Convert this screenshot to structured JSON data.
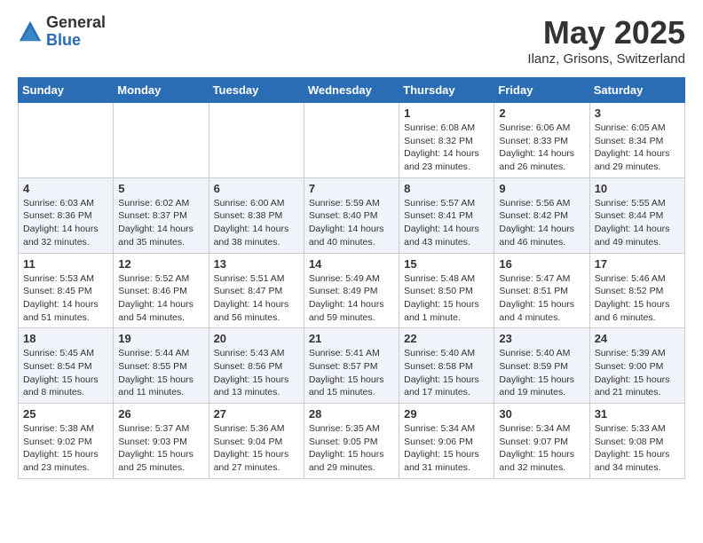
{
  "logo": {
    "general": "General",
    "blue": "Blue"
  },
  "title": "May 2025",
  "location": "Ilanz, Grisons, Switzerland",
  "weekdays": [
    "Sunday",
    "Monday",
    "Tuesday",
    "Wednesday",
    "Thursday",
    "Friday",
    "Saturday"
  ],
  "weeks": [
    [
      {
        "day": "",
        "info": ""
      },
      {
        "day": "",
        "info": ""
      },
      {
        "day": "",
        "info": ""
      },
      {
        "day": "",
        "info": ""
      },
      {
        "day": "1",
        "info": "Sunrise: 6:08 AM\nSunset: 8:32 PM\nDaylight: 14 hours\nand 23 minutes."
      },
      {
        "day": "2",
        "info": "Sunrise: 6:06 AM\nSunset: 8:33 PM\nDaylight: 14 hours\nand 26 minutes."
      },
      {
        "day": "3",
        "info": "Sunrise: 6:05 AM\nSunset: 8:34 PM\nDaylight: 14 hours\nand 29 minutes."
      }
    ],
    [
      {
        "day": "4",
        "info": "Sunrise: 6:03 AM\nSunset: 8:36 PM\nDaylight: 14 hours\nand 32 minutes."
      },
      {
        "day": "5",
        "info": "Sunrise: 6:02 AM\nSunset: 8:37 PM\nDaylight: 14 hours\nand 35 minutes."
      },
      {
        "day": "6",
        "info": "Sunrise: 6:00 AM\nSunset: 8:38 PM\nDaylight: 14 hours\nand 38 minutes."
      },
      {
        "day": "7",
        "info": "Sunrise: 5:59 AM\nSunset: 8:40 PM\nDaylight: 14 hours\nand 40 minutes."
      },
      {
        "day": "8",
        "info": "Sunrise: 5:57 AM\nSunset: 8:41 PM\nDaylight: 14 hours\nand 43 minutes."
      },
      {
        "day": "9",
        "info": "Sunrise: 5:56 AM\nSunset: 8:42 PM\nDaylight: 14 hours\nand 46 minutes."
      },
      {
        "day": "10",
        "info": "Sunrise: 5:55 AM\nSunset: 8:44 PM\nDaylight: 14 hours\nand 49 minutes."
      }
    ],
    [
      {
        "day": "11",
        "info": "Sunrise: 5:53 AM\nSunset: 8:45 PM\nDaylight: 14 hours\nand 51 minutes."
      },
      {
        "day": "12",
        "info": "Sunrise: 5:52 AM\nSunset: 8:46 PM\nDaylight: 14 hours\nand 54 minutes."
      },
      {
        "day": "13",
        "info": "Sunrise: 5:51 AM\nSunset: 8:47 PM\nDaylight: 14 hours\nand 56 minutes."
      },
      {
        "day": "14",
        "info": "Sunrise: 5:49 AM\nSunset: 8:49 PM\nDaylight: 14 hours\nand 59 minutes."
      },
      {
        "day": "15",
        "info": "Sunrise: 5:48 AM\nSunset: 8:50 PM\nDaylight: 15 hours\nand 1 minute."
      },
      {
        "day": "16",
        "info": "Sunrise: 5:47 AM\nSunset: 8:51 PM\nDaylight: 15 hours\nand 4 minutes."
      },
      {
        "day": "17",
        "info": "Sunrise: 5:46 AM\nSunset: 8:52 PM\nDaylight: 15 hours\nand 6 minutes."
      }
    ],
    [
      {
        "day": "18",
        "info": "Sunrise: 5:45 AM\nSunset: 8:54 PM\nDaylight: 15 hours\nand 8 minutes."
      },
      {
        "day": "19",
        "info": "Sunrise: 5:44 AM\nSunset: 8:55 PM\nDaylight: 15 hours\nand 11 minutes."
      },
      {
        "day": "20",
        "info": "Sunrise: 5:43 AM\nSunset: 8:56 PM\nDaylight: 15 hours\nand 13 minutes."
      },
      {
        "day": "21",
        "info": "Sunrise: 5:41 AM\nSunset: 8:57 PM\nDaylight: 15 hours\nand 15 minutes."
      },
      {
        "day": "22",
        "info": "Sunrise: 5:40 AM\nSunset: 8:58 PM\nDaylight: 15 hours\nand 17 minutes."
      },
      {
        "day": "23",
        "info": "Sunrise: 5:40 AM\nSunset: 8:59 PM\nDaylight: 15 hours\nand 19 minutes."
      },
      {
        "day": "24",
        "info": "Sunrise: 5:39 AM\nSunset: 9:00 PM\nDaylight: 15 hours\nand 21 minutes."
      }
    ],
    [
      {
        "day": "25",
        "info": "Sunrise: 5:38 AM\nSunset: 9:02 PM\nDaylight: 15 hours\nand 23 minutes."
      },
      {
        "day": "26",
        "info": "Sunrise: 5:37 AM\nSunset: 9:03 PM\nDaylight: 15 hours\nand 25 minutes."
      },
      {
        "day": "27",
        "info": "Sunrise: 5:36 AM\nSunset: 9:04 PM\nDaylight: 15 hours\nand 27 minutes."
      },
      {
        "day": "28",
        "info": "Sunrise: 5:35 AM\nSunset: 9:05 PM\nDaylight: 15 hours\nand 29 minutes."
      },
      {
        "day": "29",
        "info": "Sunrise: 5:34 AM\nSunset: 9:06 PM\nDaylight: 15 hours\nand 31 minutes."
      },
      {
        "day": "30",
        "info": "Sunrise: 5:34 AM\nSunset: 9:07 PM\nDaylight: 15 hours\nand 32 minutes."
      },
      {
        "day": "31",
        "info": "Sunrise: 5:33 AM\nSunset: 9:08 PM\nDaylight: 15 hours\nand 34 minutes."
      }
    ]
  ]
}
